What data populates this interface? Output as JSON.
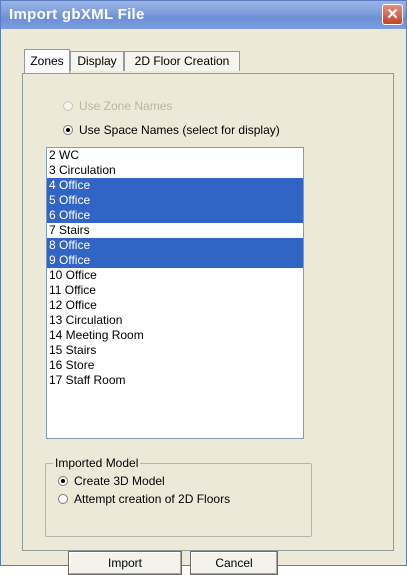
{
  "window": {
    "title": "Import gbXML File",
    "close_label": "✕"
  },
  "tabs": [
    {
      "label": "Zones"
    },
    {
      "label": "Display"
    },
    {
      "label": "2D Floor Creation"
    }
  ],
  "options": {
    "use_zone_names": "Use Zone Names",
    "use_space_names": "Use Space Names (select for display)"
  },
  "list": {
    "items": [
      {
        "label": "2 WC",
        "selected": false
      },
      {
        "label": "3 Circulation",
        "selected": false
      },
      {
        "label": "4 Office",
        "selected": true
      },
      {
        "label": "5 Office",
        "selected": true
      },
      {
        "label": "6 Office",
        "selected": true
      },
      {
        "label": "7 Stairs",
        "selected": false
      },
      {
        "label": "8 Office",
        "selected": true
      },
      {
        "label": "9 Office",
        "selected": true
      },
      {
        "label": "10 Office",
        "selected": false
      },
      {
        "label": "11 Office",
        "selected": false
      },
      {
        "label": "12 Office",
        "selected": false
      },
      {
        "label": "13 Circulation",
        "selected": false
      },
      {
        "label": "14 Meeting Room",
        "selected": false
      },
      {
        "label": "15 Stairs",
        "selected": false
      },
      {
        "label": "16 Store",
        "selected": false
      },
      {
        "label": "17 Staff Room",
        "selected": false
      }
    ]
  },
  "imported_model": {
    "legend": "Imported Model",
    "create_3d": "Create 3D Model",
    "attempt_2d": "Attempt creation of 2D Floors"
  },
  "buttons": {
    "import": "Import",
    "cancel": "Cancel"
  },
  "colors": {
    "selection": "#3165c5",
    "titlebar": "#7f9fdc",
    "close": "#c8432a"
  }
}
